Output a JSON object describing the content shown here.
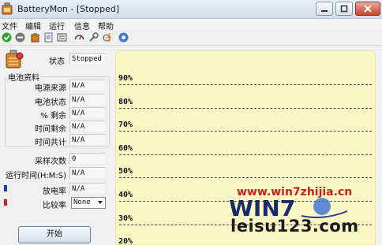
{
  "window": {
    "title": "BatteryMon - [Stopped]"
  },
  "menu": [
    "文件",
    "编辑",
    "运行",
    "信息",
    "帮助"
  ],
  "toolbar_icons": [
    "start-icon",
    "stop-icon",
    "battery-icon",
    "notes-icon",
    "settings-icon",
    "gauge-icon",
    "tools-icon",
    "charge-icon",
    "help-icon"
  ],
  "status": {
    "label": "状态",
    "value": "Stopped"
  },
  "battery_group": {
    "title": "电池资料",
    "rows": [
      {
        "label": "电源来源",
        "value": "N/A"
      },
      {
        "label": "电池状态",
        "value": "N/A"
      },
      {
        "label": "% 剩余",
        "value": "N/A"
      },
      {
        "label": "时间剩余",
        "value": "N/A"
      },
      {
        "label": "时间共计",
        "value": "N/A"
      }
    ]
  },
  "stats": [
    {
      "label": "采样次数",
      "value": "0"
    },
    {
      "label": "运行时间(H:M:S)",
      "value": "N/A"
    },
    {
      "label": "放电率",
      "value": "N/A"
    },
    {
      "label": "比较率",
      "value": "None"
    }
  ],
  "legend_colors": {
    "discharge": "#1a3fa8",
    "compare": "#cc2222"
  },
  "start_button": "开始",
  "chart_data": {
    "type": "line",
    "ylabels": [
      "90%",
      "80%",
      "70%",
      "60%",
      "50%",
      "40%",
      "30%",
      "20%"
    ],
    "series": [],
    "grid": true,
    "background": "#fbf8c5"
  },
  "watermark": {
    "site1": "www.win7zhijia.cn",
    "logo": "WIN7",
    "site2": "leisu123.com"
  }
}
